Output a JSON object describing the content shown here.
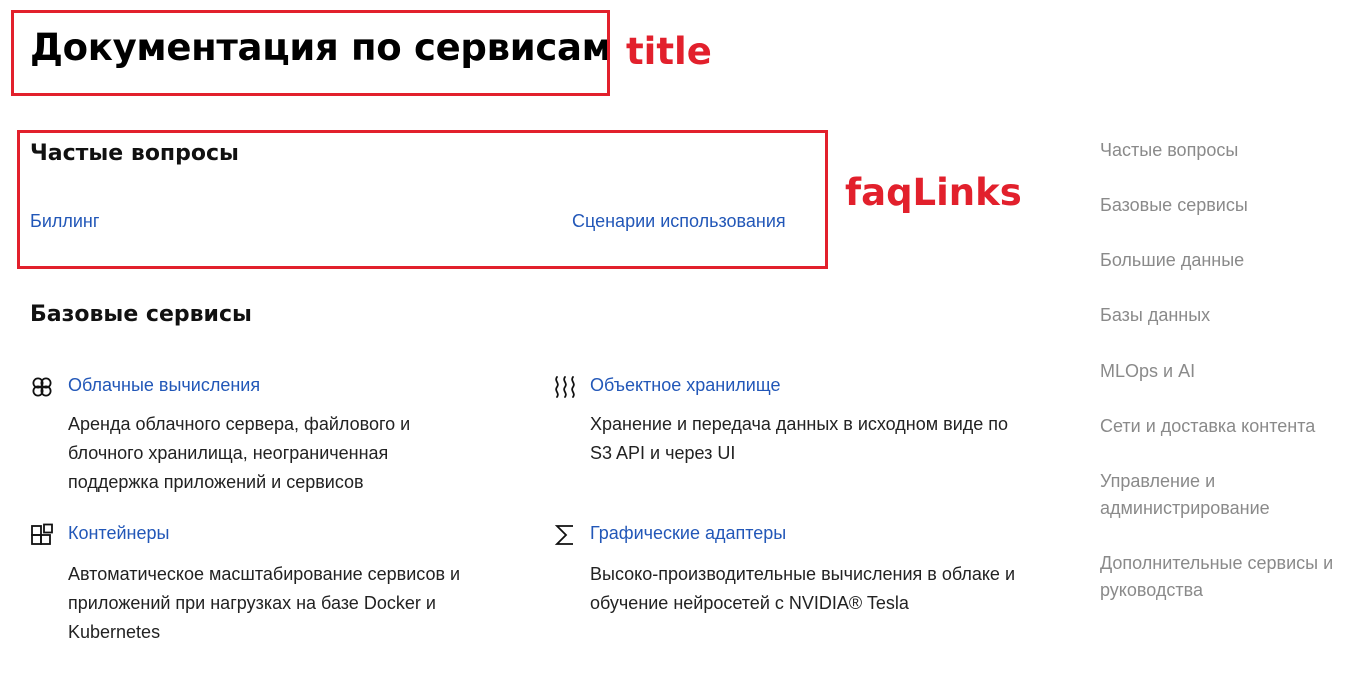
{
  "page": {
    "title": "Документация по сервисам"
  },
  "annotations": {
    "title_label": "title",
    "faq_label": "faqLinks",
    "color": "#e2202c"
  },
  "faq": {
    "heading": "Частые вопросы",
    "links": [
      "Биллинг",
      "Сценарии использования"
    ]
  },
  "base_services": {
    "heading": "Базовые сервисы",
    "items": [
      {
        "icon": "cloud-compute-icon",
        "title": "Облачные вычисления",
        "description": "Аренда облачного сервера, файлового и блочного хранилища, неограниченная поддержка приложений и сервисов"
      },
      {
        "icon": "object-storage-icon",
        "title": "Объектное хранилище",
        "description": "Хранение и передача данных в исходном виде по S3 API и через UI"
      },
      {
        "icon": "containers-icon",
        "title": "Контейнеры",
        "description": "Автоматическое масштабирование сервисов и приложений при нагрузках на базе Docker и Kubernetes"
      },
      {
        "icon": "sigma-icon",
        "title": "Графические адаптеры",
        "description": "Высоко-производительные вычисления в облаке и обучение нейросетей с NVIDIA® Tesla"
      }
    ]
  },
  "side_nav": {
    "items": [
      "Частые вопросы",
      "Базовые сервисы",
      "Большие данные",
      "Базы данных",
      "MLOps и AI",
      "Сети и доставка контента",
      "Управление и администрирование",
      "Дополнительные сервисы и руководства"
    ]
  },
  "colors": {
    "link": "#2257b8",
    "side_nav_text": "#8a8a8a",
    "annotation": "#e2202c"
  }
}
